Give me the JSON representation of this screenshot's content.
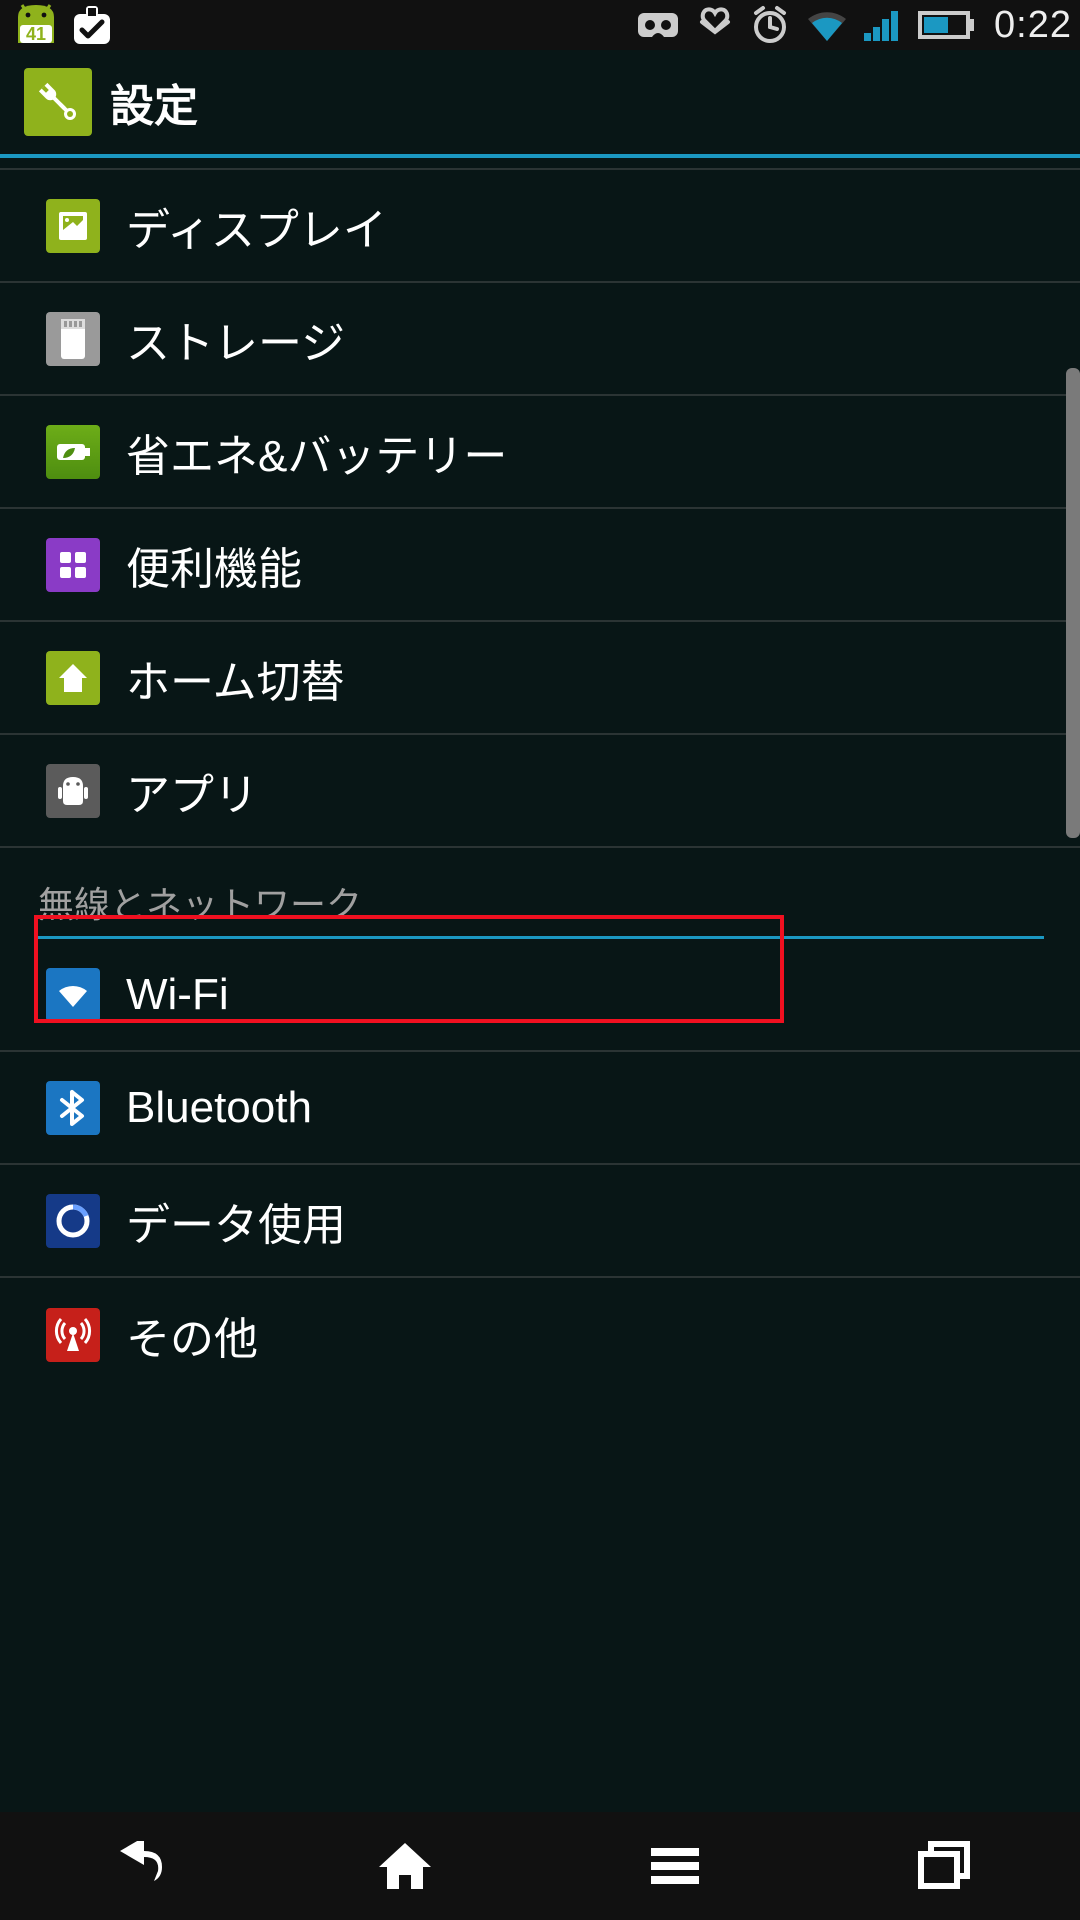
{
  "status_bar": {
    "battery_badge": "41",
    "time": "0:22"
  },
  "header": {
    "title": "設定"
  },
  "settings": {
    "items": [
      {
        "label": "ディスプレイ"
      },
      {
        "label": "ストレージ"
      },
      {
        "label": "省エネ&バッテリー"
      },
      {
        "label": "便利機能"
      },
      {
        "label": "ホーム切替"
      },
      {
        "label": "アプリ"
      }
    ]
  },
  "section": {
    "header": "無線とネットワーク",
    "items": [
      {
        "label": "Wi-Fi"
      },
      {
        "label": "Bluetooth"
      },
      {
        "label": "データ使用"
      },
      {
        "label": "その他"
      }
    ]
  }
}
